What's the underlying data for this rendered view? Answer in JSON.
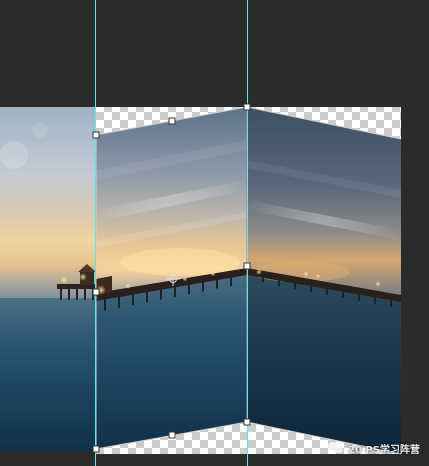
{
  "app": {
    "canvas_background": "#2b2b2b",
    "guide_color": "#5fe6e6",
    "transparency_checker": true
  },
  "watermark": {
    "icon": "wechat-icon",
    "text": "20 PS学习阵营"
  },
  "transform": {
    "mode": "warp",
    "handle_count": 8
  }
}
